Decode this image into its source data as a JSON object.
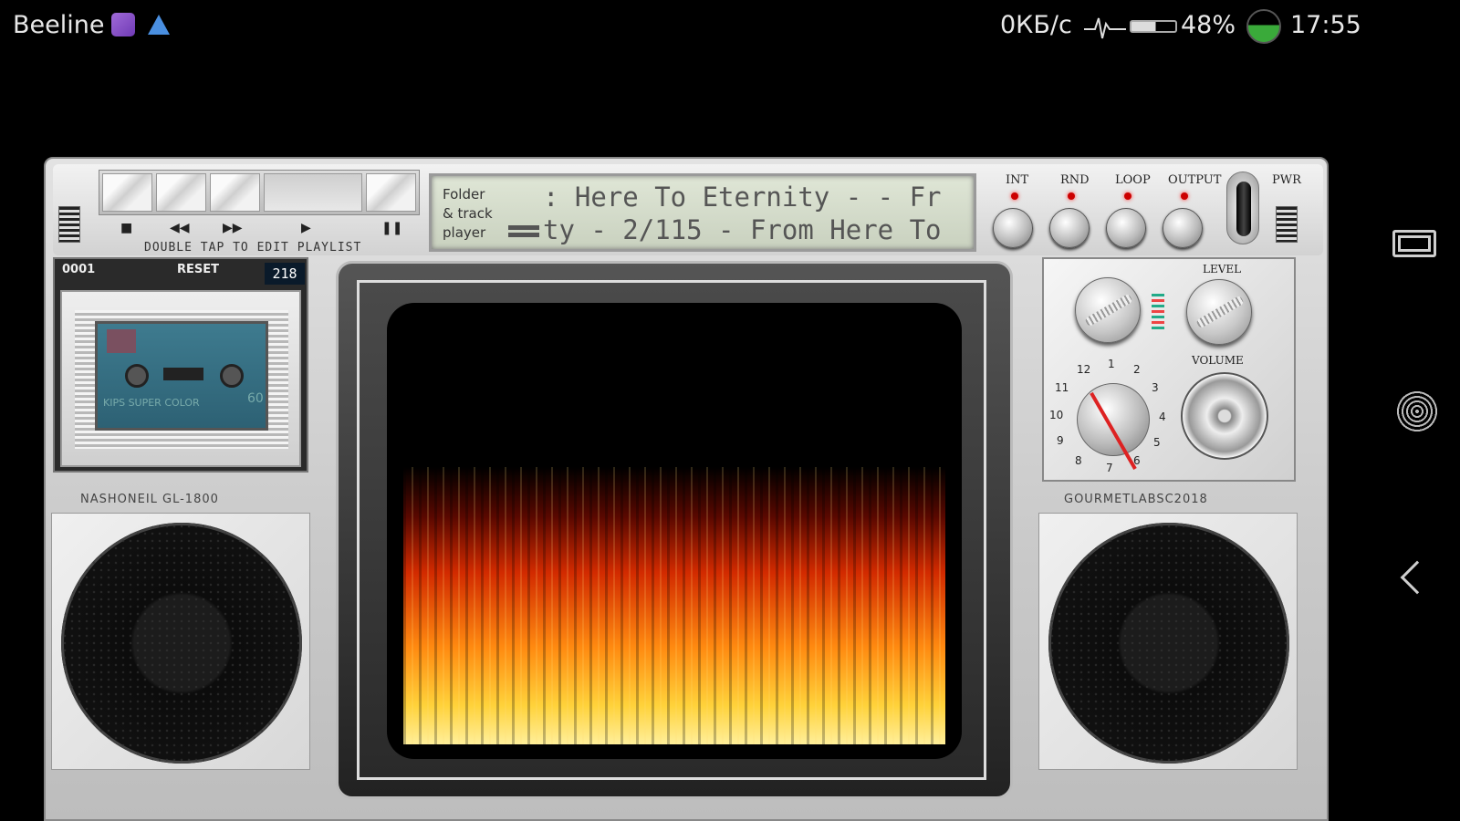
{
  "status_bar": {
    "carrier": "Beeline",
    "net_speed": "0КБ/с",
    "battery": "48%",
    "time": "17:55"
  },
  "player": {
    "instruction": "DOUBLE TAP TO EDIT PLAYLIST",
    "display": {
      "label_line1": "Folder",
      "label_line2": "& track",
      "label_line3": "player",
      "line1": ": Here To Eternity -  - Fr",
      "line2": "ty - 2/115 - From Here To"
    },
    "controls": {
      "int": "INT",
      "rnd": "RND",
      "loop": "LOOP",
      "output": "OUTPUT",
      "pwr": "PWR"
    },
    "counter": {
      "label": "0001",
      "reset": "RESET",
      "value": "218"
    },
    "cassette": {
      "brand_text": "KIPS SUPER COLOR",
      "length": "60"
    },
    "brand_left": "NASHONEIL GL-1800",
    "brand_right": "GOURMETLABSC2018",
    "right_panel": {
      "level": "LEVEL",
      "volume": "VOLUME",
      "dial_numbers": [
        "12",
        "1",
        "2",
        "3",
        "4",
        "5",
        "6",
        "7",
        "8",
        "9",
        "10",
        "11"
      ]
    }
  }
}
